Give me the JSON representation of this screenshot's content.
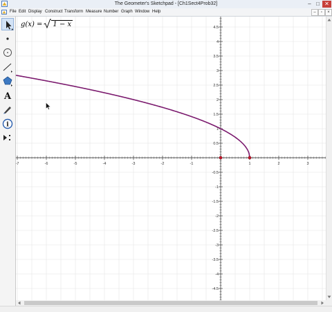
{
  "window": {
    "title": "The Geometer's Sketchpad - [Ch1Sect4Prob32]"
  },
  "menu": [
    {
      "label": "File"
    },
    {
      "label": "Edit"
    },
    {
      "label": "Display"
    },
    {
      "label": "Construct"
    },
    {
      "label": "Transform"
    },
    {
      "label": "Measure"
    },
    {
      "label": "Number"
    },
    {
      "label": "Graph"
    },
    {
      "label": "Window"
    },
    {
      "label": "Help"
    }
  ],
  "window_controls": {
    "minimize": "–",
    "maximize": "□",
    "close": "✕"
  },
  "mdi_controls": {
    "minimize": "–",
    "restore": "▫",
    "close": "×"
  },
  "tools": [
    {
      "name": "arrow-tool-icon",
      "selected": true
    },
    {
      "name": "point-tool-icon"
    },
    {
      "name": "compass-tool-icon"
    },
    {
      "name": "straightedge-tool-icon"
    },
    {
      "name": "polygon-tool-icon"
    },
    {
      "name": "text-tool-icon",
      "glyph": "A"
    },
    {
      "name": "marker-tool-icon"
    },
    {
      "name": "information-tool-icon",
      "glyph": "i"
    },
    {
      "name": "custom-tool-icon"
    }
  ],
  "function_label": {
    "name": "g(x) =",
    "radicand": "1 − x"
  },
  "graph": {
    "x_tick_labels": [
      "-7",
      "-6",
      "-5",
      "-4",
      "-3",
      "-2",
      "-1",
      "1",
      "2",
      "3"
    ],
    "y_tick_labels": [
      "4.5",
      "4",
      "3.5",
      "3",
      "2.5",
      "2",
      "1.5",
      "1",
      "0.5",
      "-0.5",
      "-1",
      "-1.5",
      "-2",
      "-2.5",
      "-3",
      "-3.5",
      "-4",
      "-4.5"
    ],
    "curve_color": "#7b1a6e",
    "point_color": "#c0152a",
    "axis_color": "#555555",
    "grid_color": "#e4e4e4",
    "points": [
      {
        "x": 0,
        "y": 0
      },
      {
        "x": 1,
        "y": 0
      }
    ]
  }
}
